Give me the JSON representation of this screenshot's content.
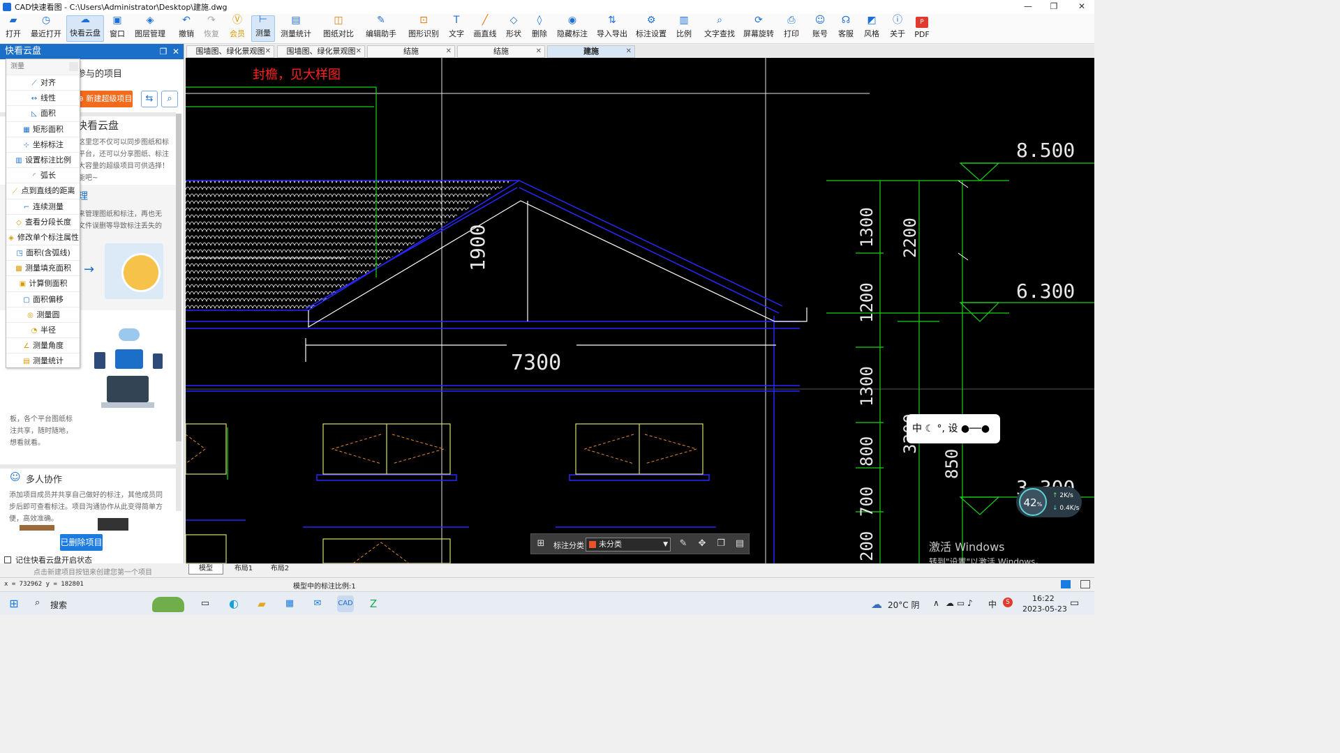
{
  "window": {
    "title": "CAD快速看图 - C:\\Users\\Administrator\\Desktop\\建施.dwg",
    "controls": [
      "—",
      "❐",
      "✕"
    ]
  },
  "toolbar": [
    {
      "label": "打开",
      "icon": "folder-icon"
    },
    {
      "label": "最近打开",
      "icon": "recent-icon"
    },
    {
      "label": "快看云盘",
      "icon": "cloud-icon"
    },
    {
      "label": "窗口",
      "icon": "window-icon"
    },
    {
      "label": "图层管理",
      "icon": "layers-icon"
    },
    {
      "label": "撤销",
      "icon": "undo-icon"
    },
    {
      "label": "恢复",
      "icon": "redo-icon"
    },
    {
      "label": "会员",
      "icon": "vip-icon"
    },
    {
      "label": "测量",
      "icon": "measure-icon"
    },
    {
      "label": "测量统计",
      "icon": "measure-stats-icon"
    },
    {
      "label": "图纸对比",
      "icon": "compare-icon"
    },
    {
      "label": "编辑助手",
      "icon": "edit-assistant-icon"
    },
    {
      "label": "图形识别",
      "icon": "shape-recognize-icon"
    },
    {
      "label": "文字",
      "icon": "text-icon"
    },
    {
      "label": "画直线",
      "icon": "line-icon"
    },
    {
      "label": "形状",
      "icon": "shape-icon"
    },
    {
      "label": "删除",
      "icon": "eraser-icon"
    },
    {
      "label": "隐藏标注",
      "icon": "eye-off-icon"
    },
    {
      "label": "导入导出",
      "icon": "import-export-icon"
    },
    {
      "label": "标注设置",
      "icon": "annotation-settings-icon"
    },
    {
      "label": "比例",
      "icon": "scale-icon"
    },
    {
      "label": "文字查找",
      "icon": "text-search-icon"
    },
    {
      "label": "屏幕旋转",
      "icon": "rotate-screen-icon"
    },
    {
      "label": "打印",
      "icon": "printer-icon"
    },
    {
      "label": "账号",
      "icon": "user-icon"
    },
    {
      "label": "客服",
      "icon": "headset-icon"
    },
    {
      "label": "风格",
      "icon": "style-icon"
    },
    {
      "label": "关于",
      "icon": "info-icon"
    },
    {
      "label": "PDF",
      "icon": "pdf-icon"
    }
  ],
  "left_panel": {
    "title": "快看云盘",
    "tab_projects": "参与的项目",
    "new_project": "新建超级项目",
    "cloud_title": "快看云盘",
    "cloud_text": [
      "这里您不仅可以同步图纸和标",
      "平台，还可以分享图纸、标注",
      "大容量的超级项目可供选择！",
      "能吧~"
    ],
    "manage_title": "理",
    "manage_text": [
      "来管理图纸和标注，再也无",
      "文件误删等导致标注丢失的"
    ],
    "share_text": [
      "板，各个平台图纸标",
      "注共享，随时随地，",
      "想看就看。"
    ],
    "collab_title": "多人协作",
    "collab_text": [
      "添加项目成员并共享自己做好的标注，其他成员同",
      "步后即可查看标注。项目沟通协作从此变得简单方",
      "便，高效准确。"
    ],
    "deleted_button": "已删除项目",
    "remember_label": "记住快看云盘开启状态",
    "hint": "点击新建项目按钮来创建您第一个项目"
  },
  "measure_menu": {
    "header": "测量",
    "items": [
      "对齐",
      "线性",
      "面积",
      "矩形面积",
      "坐标标注",
      "设置标注比例",
      "弧长",
      "点到直线的距离",
      "连续测量",
      "查看分段长度",
      "修改单个标注属性",
      "面积(含弧线)",
      "测量填充面积",
      "计算侧面积",
      "面积偏移",
      "测量圆",
      "半径",
      "测量角度",
      "测量统计"
    ]
  },
  "doc_tabs": [
    {
      "label": "围墙图、绿化景观图",
      "active": false
    },
    {
      "label": "围墙图、绿化景观图",
      "active": false
    },
    {
      "label": "结施",
      "active": false
    },
    {
      "label": "结施",
      "active": false
    },
    {
      "label": "建施",
      "active": true
    }
  ],
  "drawing": {
    "note": "封檐，见大样图",
    "elev_top": "8.500",
    "elev_mid": "6.300",
    "elev_low": "3.300",
    "dim_ridge": "1900",
    "dim_span": "7300",
    "dims_col1": [
      "1300",
      "1200",
      "1300",
      "800",
      "700",
      "200"
    ],
    "dims_col2": [
      "2200",
      "3300",
      "850"
    ]
  },
  "annotation_bar": {
    "label": "标注分类",
    "value": "未分类"
  },
  "ime": {
    "text": "中 ☾ °, 设"
  },
  "speed": {
    "percent": "42",
    "unit": "%",
    "up": "2K/s",
    "down": "0.4K/s"
  },
  "watermark": {
    "line1": "激活 Windows",
    "line2": "转到\"设置\"以激活 Windows。"
  },
  "layout_tabs": [
    "模型",
    "布局1",
    "布局2"
  ],
  "status": {
    "coords": "x = 732962  y = 182801",
    "scale": "模型中的标注比例:1"
  },
  "taskbar": {
    "search": "搜索",
    "weather": "20°C 阴",
    "ime": "中",
    "time": "16:22",
    "date": "2023-05-23"
  },
  "colors": {
    "accent": "#1b6fc9",
    "orange": "#f26b1d",
    "cad_green": "#19d419",
    "cad_blue": "#2020e0",
    "cad_red": "#ff2020"
  }
}
